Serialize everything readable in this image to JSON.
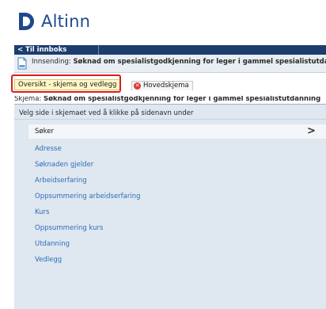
{
  "brand": {
    "name": "Altinn",
    "color": "#1d4a8c"
  },
  "topbar": {
    "back_label": "< Til innboks"
  },
  "submission": {
    "prefix": "Innsending: ",
    "title": "Søknad om spesialistgodkjenning for leger i gammel spesialistutdanning"
  },
  "tabs": {
    "overview": "Oversikt - skjema og vedlegg",
    "main": "Hovedskjema"
  },
  "schema": {
    "prefix": "Skjema: ",
    "title": "Søknad om spesialistgodkjenning for leger i gammel spesialistutdanning"
  },
  "nav": {
    "instruction": "Velg side i skjemaet ved å klikke på sidenavn under",
    "active": {
      "label": "Søker",
      "chevron": ">"
    },
    "items": [
      "Adresse",
      "Søknaden gjelder",
      "Arbeidserfaring",
      "Oppsummering arbeidserfaring",
      "Kurs",
      "Oppsummering kurs",
      "Utdanning",
      "Vedlegg"
    ]
  },
  "colors": {
    "highlight": "#d51f24",
    "link": "#2c6fb6",
    "topbar": "#1c3d6e",
    "panel": "#dfe7f0"
  }
}
